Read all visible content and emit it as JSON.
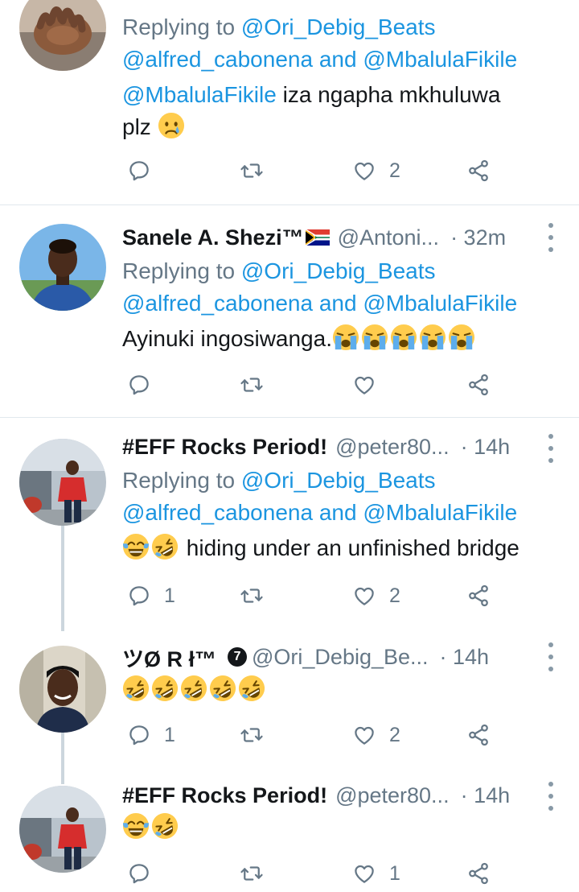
{
  "tweets": [
    {
      "name": "",
      "handle": "",
      "time": "",
      "reply_label": "Replying to",
      "reply_line1": "@Ori_Debig_Beats",
      "reply_line2_a": "@alfred_cabonena",
      "reply_and": " and ",
      "reply_line2_b": "@MbalulaFikile",
      "text_mention": "@MbalulaFikile",
      "text_a": " iza ngapha mkhuluwa",
      "text_b": "plz",
      "emojis": [
        "crying-face"
      ],
      "replies": "",
      "likes": "2"
    },
    {
      "name": "Sanele A. Shezi™",
      "handle": "@Antoni...",
      "time": "· 32m",
      "reply_label": "Replying to",
      "reply_line1": "@Ori_Debig_Beats",
      "reply_line2_a": "@alfred_cabonena",
      "reply_and": " and ",
      "reply_line2_b": "@MbalulaFikile",
      "text": "Ayinuki ingosiwanga.",
      "emojis": [
        "loudly-crying-face",
        "loudly-crying-face",
        "loudly-crying-face",
        "loudly-crying-face",
        "loudly-crying-face"
      ],
      "replies": "",
      "likes": ""
    },
    {
      "name": "#EFF Rocks Period!",
      "handle": "@peter80...",
      "time": "· 14h",
      "reply_label": "Replying to",
      "reply_line1": "@Ori_Debig_Beats",
      "reply_line2_a": "@alfred_cabonena",
      "reply_and": " and ",
      "reply_line2_b": "@MbalulaFikile",
      "text": " hiding under an unfinished bridge",
      "emojis": [
        "tears-of-joy",
        "rolling-laughing"
      ],
      "replies": "1",
      "likes": "2"
    },
    {
      "name": "ツØ R ł™",
      "badge": "7",
      "handle": "@Ori_Debig_Be...",
      "time": "· 14h",
      "emojis": [
        "rolling-laughing",
        "rolling-laughing",
        "rolling-laughing",
        "rolling-laughing",
        "rolling-laughing"
      ],
      "replies": "1",
      "likes": "2"
    },
    {
      "name": "#EFF Rocks Period!",
      "handle": "@peter80...",
      "time": "· 14h",
      "emojis": [
        "tears-of-joy",
        "rolling-laughing"
      ],
      "replies": "",
      "likes": "1"
    }
  ],
  "colors": {
    "link": "#1b95e0",
    "muted": "#657786",
    "divider": "#e1e8ed",
    "thread": "#ccd6dd"
  }
}
